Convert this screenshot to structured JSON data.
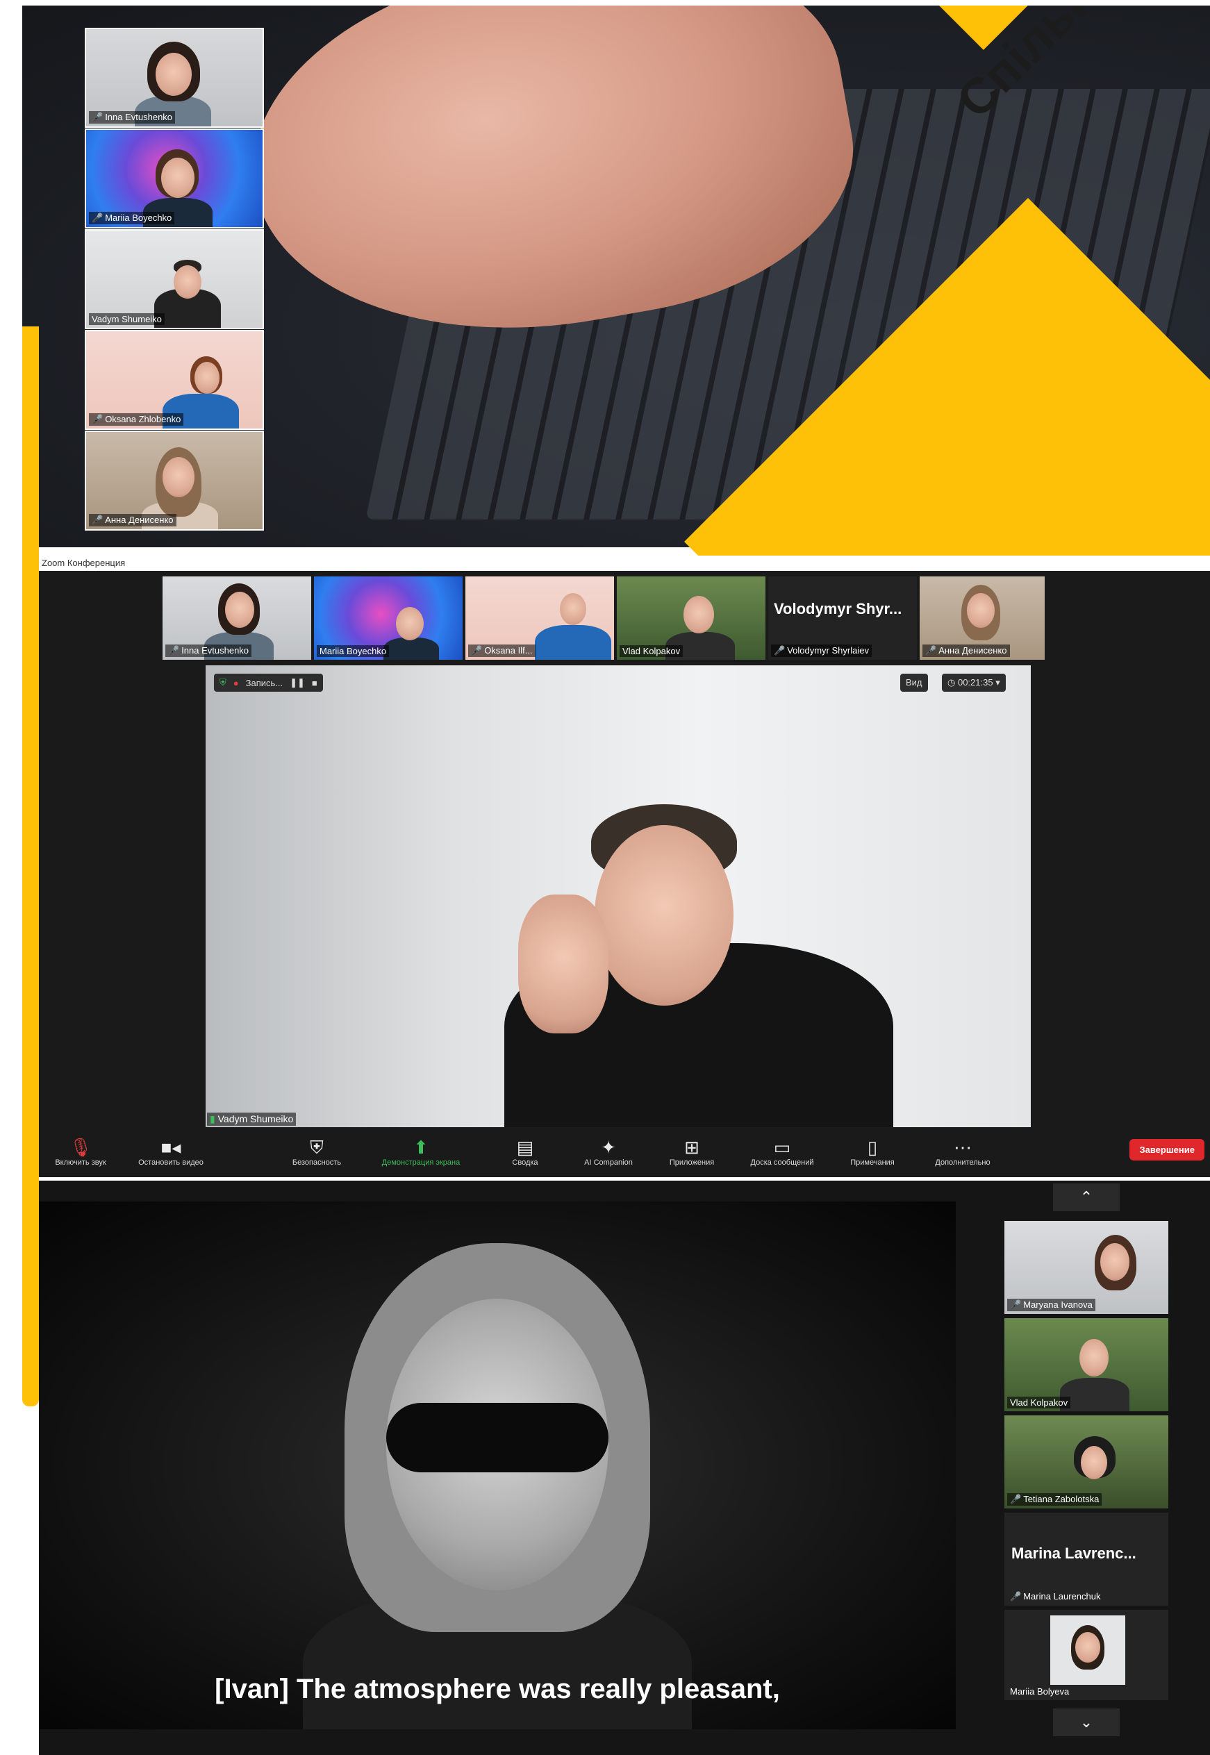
{
  "banner": {
    "text": "Спільнодієм"
  },
  "section1": {
    "thumbnails": [
      {
        "name": "Inna Evtushenko"
      },
      {
        "name": "Mariia Boyechko"
      },
      {
        "name": "Vadym Shumeiko"
      },
      {
        "name": "Oksana Zhlobenko"
      },
      {
        "name": "Анна Денисенко"
      }
    ]
  },
  "zoom": {
    "window_title": "Zoom Конференция",
    "strip": [
      {
        "name": "Inna Evtushenko"
      },
      {
        "name": "Mariia Boyechko"
      },
      {
        "name": "Oksana Ilf..."
      },
      {
        "name": "Vlad Kolpakov"
      },
      {
        "name": "Volodymyr Shyrlaiev",
        "big_name": "Volodymyr Shyr..."
      },
      {
        "name": "Анна Денисенко"
      }
    ],
    "recording_label": "Запись...",
    "view_button": "Вид",
    "timer": "00:21:35",
    "active_speaker": "Vadym Shumeiko",
    "toolbar": [
      {
        "label": "Включить звук",
        "icon": "mic-muted"
      },
      {
        "label": "Остановить видео",
        "icon": "camera"
      },
      {
        "label": "Безопасность",
        "icon": "shield"
      },
      {
        "label": "Демонстрация экрана",
        "icon": "share-screen"
      },
      {
        "label": "Сводка",
        "icon": "summary"
      },
      {
        "label": "AI Companion",
        "icon": "sparkle"
      },
      {
        "label": "Приложения",
        "icon": "apps"
      },
      {
        "label": "Доска сообщений",
        "icon": "whiteboard"
      },
      {
        "label": "Примечания",
        "icon": "notes"
      },
      {
        "label": "Дополнительно",
        "icon": "more"
      }
    ],
    "end_button": "Завершение"
  },
  "section3": {
    "caption": "[Ivan] The atmosphere was really pleasant,",
    "side": [
      {
        "name": "Maryana Ivanova"
      },
      {
        "name": "Vlad Kolpakov"
      },
      {
        "name": "Tetiana Zabolotska"
      },
      {
        "name": "Marina Laurenchuk",
        "big_name": "Marina Lavrenc..."
      },
      {
        "name": "Mariia Bolyeva"
      }
    ]
  }
}
